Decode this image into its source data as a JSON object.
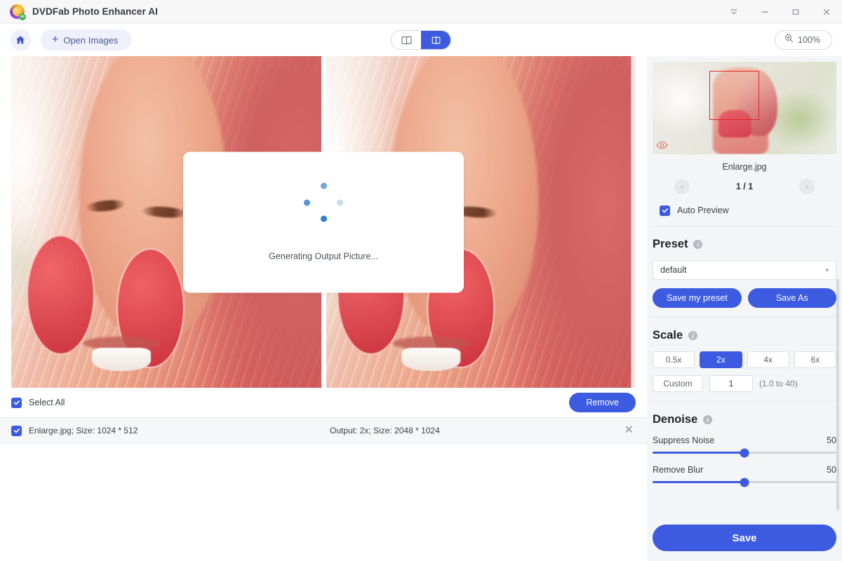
{
  "window": {
    "title": "DVDFab Photo Enhancer AI",
    "logo_badge": "AI",
    "controls": {
      "collapse": "collapse-icon",
      "minimize": "minimize-icon",
      "maximize": "maximize-icon",
      "close": "close-icon"
    }
  },
  "toolbar": {
    "home_icon": "home-icon",
    "open_plus": "+",
    "open_label": "Open Images",
    "view_modes": [
      {
        "name": "single-view",
        "icon": "split-pane-icon",
        "active": false
      },
      {
        "name": "compare-view",
        "icon": "compare-pane-icon",
        "active": true
      }
    ],
    "zoom_icon": "zoom-in-icon",
    "zoom_level": "100%"
  },
  "preview": {
    "loading_text": "Generating Output Picture...",
    "spinner": "dots-spinner"
  },
  "filelist": {
    "select_all_label": "Select All",
    "remove_label": "Remove",
    "rows": [
      {
        "name": "Enlarge.jpg; Size: 1024 * 512",
        "output": "Output: 2x; Size: 2048 * 1024",
        "close": "✕",
        "checked": true
      }
    ]
  },
  "sidebar": {
    "thumbnail": {
      "filename": "Enlarge.jpg",
      "selection_color": "#e02a28",
      "eye_icon": "eye-icon"
    },
    "pager": {
      "prev": "‹",
      "next": "›",
      "count": "1 / 1"
    },
    "auto_preview": {
      "label": "Auto Preview",
      "checked": true
    },
    "preset": {
      "title": "Preset",
      "info": "i",
      "selected": "default",
      "caret": "▾",
      "save_my_preset": "Save my preset",
      "save_as": "Save As"
    },
    "scale": {
      "title": "Scale",
      "info": "i",
      "options": [
        {
          "label": "0.5x",
          "active": false
        },
        {
          "label": "2x",
          "active": true
        },
        {
          "label": "4x",
          "active": false
        },
        {
          "label": "6x",
          "active": false
        }
      ],
      "custom_label": "Custom",
      "custom_value": "1",
      "range_hint": "(1.0 to 40)"
    },
    "denoise": {
      "title": "Denoise",
      "info": "i",
      "sliders": [
        {
          "label": "Suppress Noise",
          "value": 50
        },
        {
          "label": "Remove Blur",
          "value": 50
        }
      ]
    },
    "save_label": "Save"
  },
  "colors": {
    "accent": "#3c5be0",
    "sidebar_bg": "#f4f5f7",
    "titlebar_bg": "#f7f7f7"
  }
}
